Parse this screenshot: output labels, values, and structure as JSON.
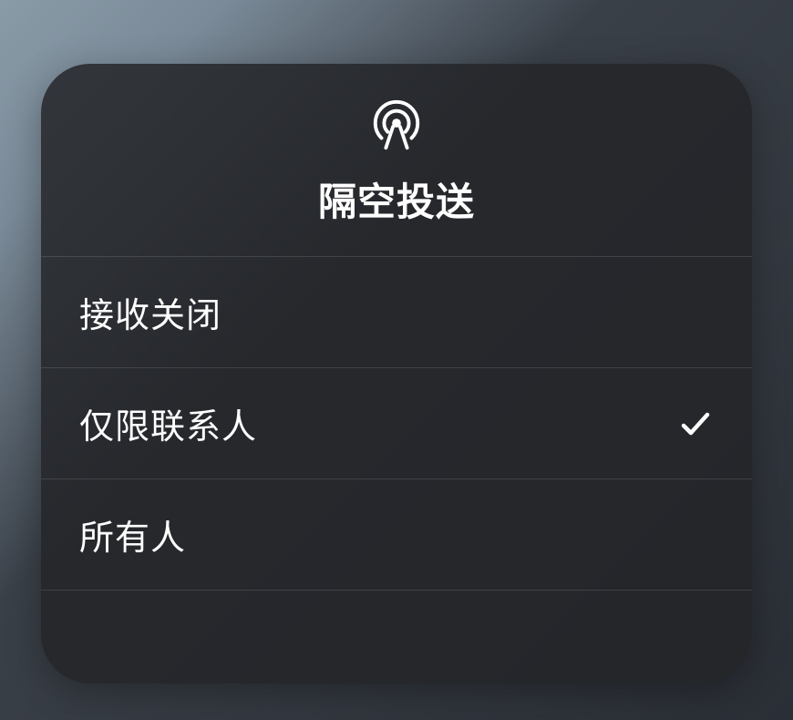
{
  "header": {
    "title": "隔空投送",
    "icon_name": "airdrop-icon"
  },
  "options": [
    {
      "label": "接收关闭",
      "selected": false
    },
    {
      "label": "仅限联系人",
      "selected": true
    },
    {
      "label": "所有人",
      "selected": false
    }
  ]
}
